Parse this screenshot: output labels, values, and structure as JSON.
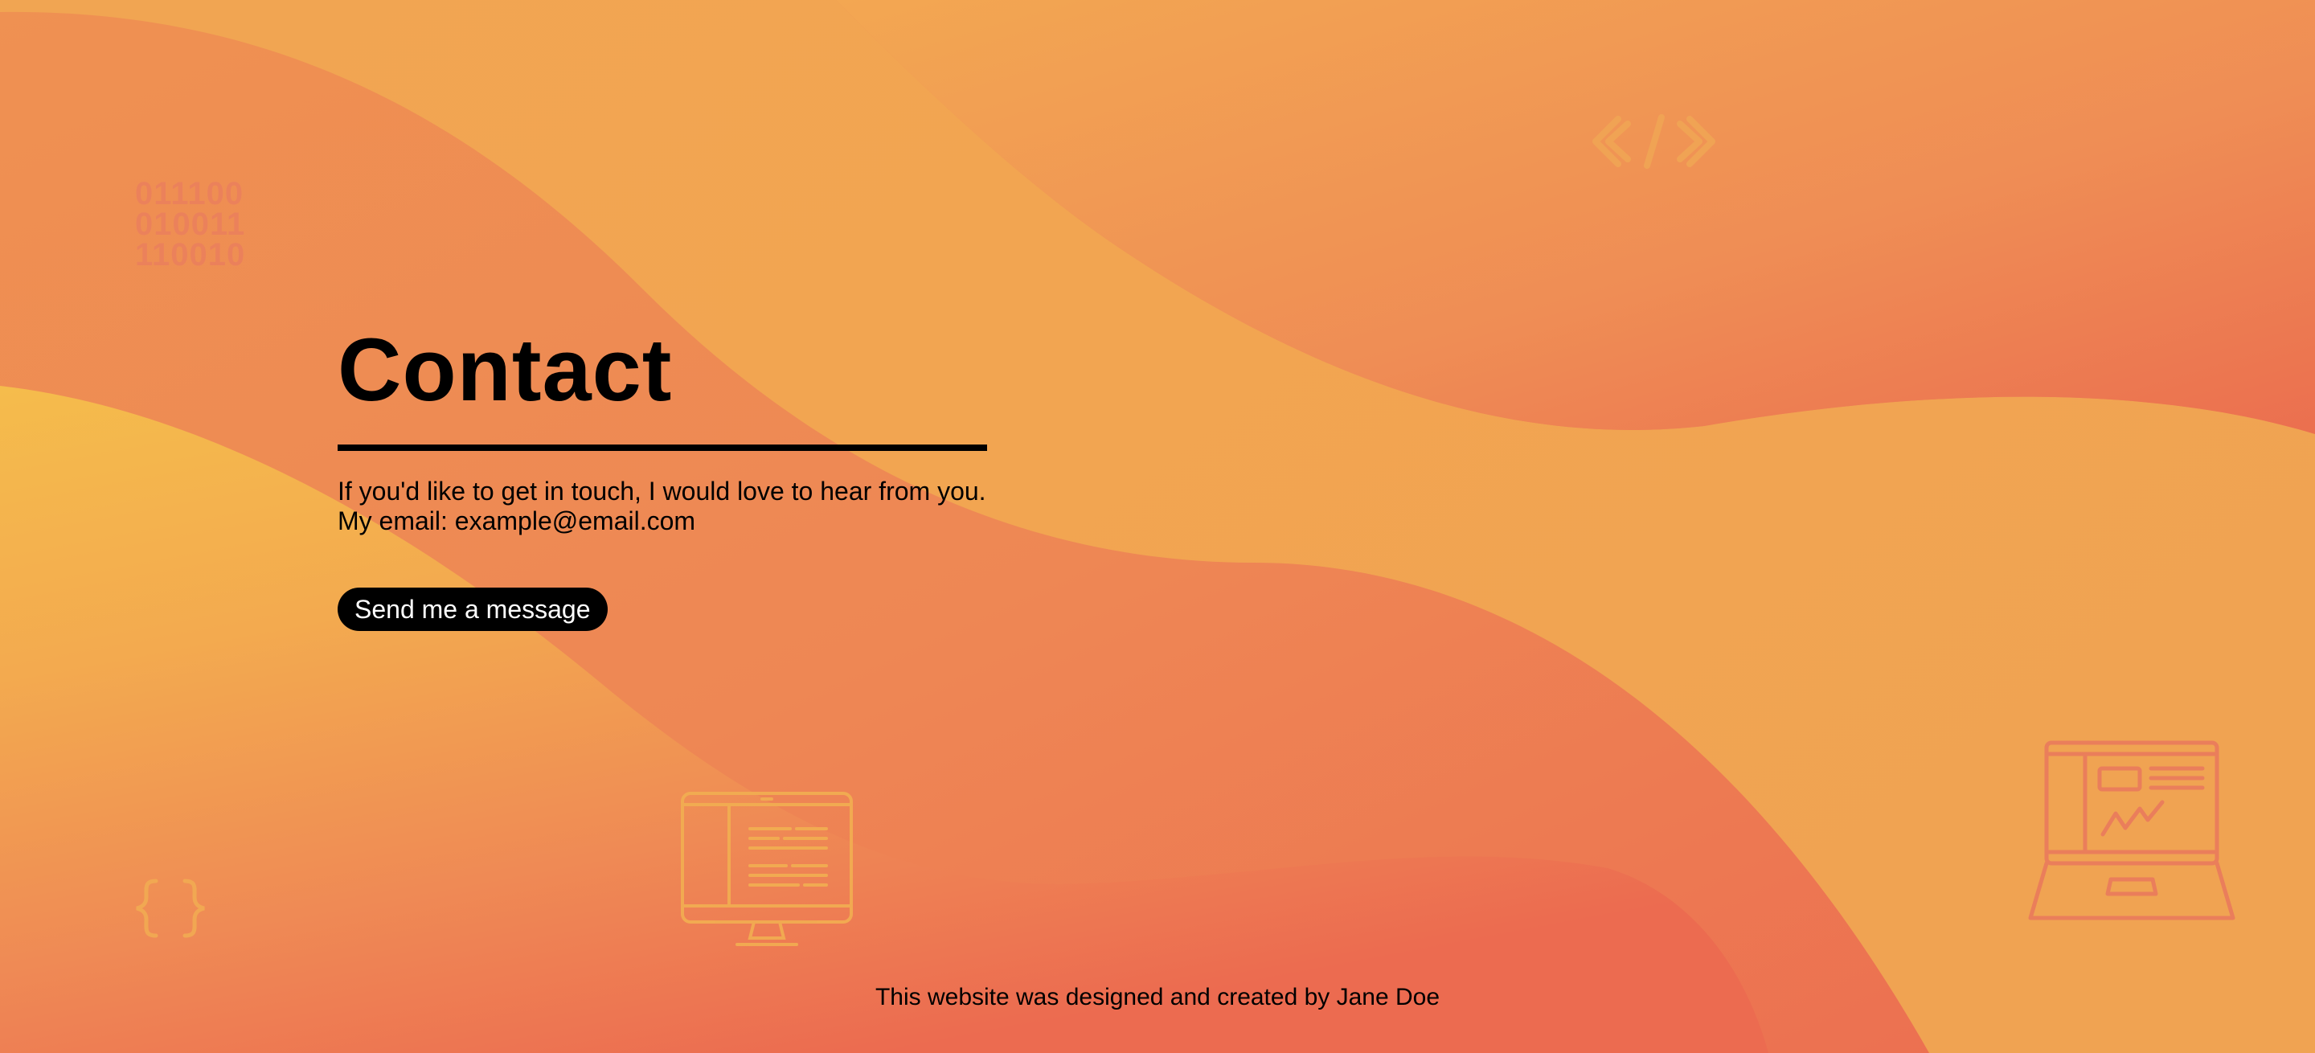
{
  "contact": {
    "title": "Contact",
    "intro_line1": "If you'd like to get in touch, I would love to hear from you.",
    "intro_line2": "My email: example@email.com",
    "button_label": "Send me a message"
  },
  "footer": {
    "credit": "This website was designed and created by Jane Doe"
  },
  "decorations": {
    "binary_row1": "011100",
    "binary_row2": "010011",
    "binary_row3": "110010",
    "code_icon": "code-brackets-icon",
    "braces_icon": "curly-braces-icon",
    "monitor_icon": "monitor-icon",
    "laptop_icon": "laptop-icon"
  },
  "colors": {
    "yellow": "#f5bb4c",
    "orange": "#ef8a55",
    "coral": "#ec6b50",
    "text": "#000000",
    "button_bg": "#000000",
    "button_text": "#ffffff"
  }
}
